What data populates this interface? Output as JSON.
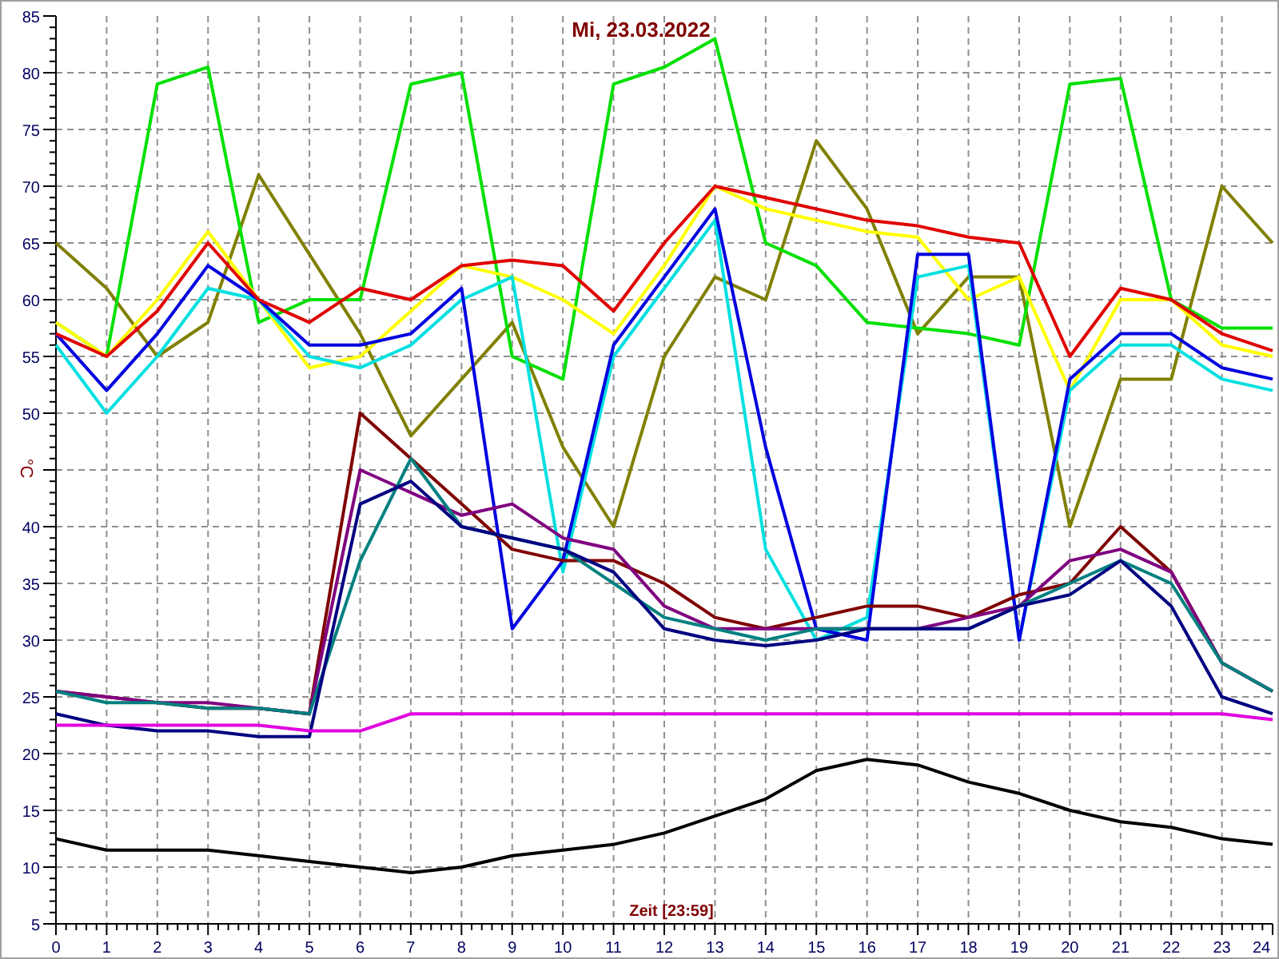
{
  "chart": {
    "chart_data": {
      "type": "line",
      "title": "Mi, 23.03.2022",
      "xlabel": "Zeit [23:59]",
      "ylabel": "°C",
      "grid": true,
      "x": [
        0,
        1,
        2,
        3,
        4,
        5,
        6,
        7,
        8,
        9,
        10,
        11,
        12,
        13,
        14,
        15,
        16,
        17,
        18,
        19,
        20,
        21,
        22,
        23,
        24
      ],
      "xlim": [
        0,
        24
      ],
      "ylim": [
        5,
        85
      ],
      "xticks": [
        0,
        1,
        2,
        3,
        4,
        5,
        6,
        7,
        8,
        9,
        10,
        11,
        12,
        13,
        14,
        15,
        16,
        17,
        18,
        19,
        20,
        21,
        22,
        23,
        24
      ],
      "yticks": [
        5,
        10,
        15,
        20,
        25,
        30,
        35,
        40,
        50,
        55,
        60,
        65,
        70,
        75,
        80,
        85
      ],
      "series": [
        {
          "color": "#808000",
          "values": [
            65,
            61,
            55,
            58,
            71,
            64,
            57,
            48,
            53,
            58,
            47,
            40,
            55,
            62,
            60,
            74,
            68,
            57,
            62,
            62,
            40,
            53,
            53,
            70,
            65
          ]
        },
        {
          "color": "#00e000",
          "values": [
            58,
            55,
            79,
            80.5,
            58,
            60,
            60,
            79,
            80,
            55,
            53,
            79,
            80.5,
            83,
            65,
            63,
            58,
            57.5,
            57,
            56,
            79,
            79.5,
            60,
            57.5,
            57.5
          ]
        },
        {
          "color": "#ffff00",
          "values": [
            58,
            55,
            60,
            66,
            60,
            54,
            55,
            59,
            63,
            62,
            60,
            57,
            63,
            70,
            68,
            67,
            66,
            65.5,
            60,
            62,
            52,
            60,
            60,
            56,
            55
          ]
        },
        {
          "color": "#00e0e0",
          "values": [
            56,
            50,
            55,
            61,
            60,
            55,
            54,
            56,
            60,
            62,
            36,
            55,
            61,
            67,
            38,
            30,
            32,
            62,
            63,
            30,
            52,
            56,
            56,
            53,
            52
          ]
        },
        {
          "color": "#0000e0",
          "values": [
            57,
            52,
            57,
            63,
            60,
            56,
            56,
            57,
            61,
            31,
            37,
            56,
            62,
            68,
            47,
            31,
            30,
            64,
            64,
            30,
            53,
            57,
            57,
            54,
            53
          ]
        },
        {
          "color": "#e00000",
          "values": [
            57,
            55,
            59,
            65,
            60,
            58,
            61,
            60,
            63,
            63.5,
            63,
            59,
            65,
            70,
            69,
            68,
            67,
            66.5,
            65.5,
            65,
            55,
            61,
            60,
            57,
            55.5
          ]
        },
        {
          "color": "#800000",
          "values": [
            25.5,
            25,
            24.5,
            24,
            24,
            23.5,
            50,
            46,
            42,
            38,
            37,
            37,
            35,
            32,
            31,
            32,
            33,
            33,
            32,
            34,
            35,
            40,
            36,
            28,
            25.5
          ]
        },
        {
          "color": "#800080",
          "values": [
            25.5,
            25,
            24.5,
            24.5,
            24,
            23.5,
            45,
            43,
            41,
            42,
            39,
            38,
            33,
            31,
            31,
            31,
            31,
            31,
            32,
            33,
            37,
            38,
            36,
            28,
            25.5
          ]
        },
        {
          "color": "#008080",
          "values": [
            25.5,
            24.5,
            24.5,
            24,
            24,
            23.5,
            37,
            46,
            40,
            39,
            38,
            35,
            32,
            31,
            30,
            31,
            31,
            31,
            31,
            33,
            35,
            37,
            35,
            28,
            25.5
          ]
        },
        {
          "color": "#000080",
          "values": [
            23.5,
            22.5,
            22,
            22,
            21.5,
            21.5,
            42,
            44,
            40,
            39,
            38,
            36,
            31,
            30,
            29.5,
            30,
            31,
            31,
            31,
            33,
            34,
            37,
            33,
            25,
            23.5
          ]
        },
        {
          "color": "#e000e0",
          "values": [
            22.5,
            22.5,
            22.5,
            22.5,
            22.5,
            22,
            22,
            23.5,
            23.5,
            23.5,
            23.5,
            23.5,
            23.5,
            23.5,
            23.5,
            23.5,
            23.5,
            23.5,
            23.5,
            23.5,
            23.5,
            23.5,
            23.5,
            23.5,
            23
          ]
        },
        {
          "color": "#000000",
          "values": [
            12.5,
            11.5,
            11.5,
            11.5,
            11,
            10.5,
            10,
            9.5,
            10,
            11,
            11.5,
            12,
            13,
            14.5,
            16,
            18.5,
            19.5,
            19,
            17.5,
            16.5,
            15,
            14,
            13.5,
            12.5,
            12
          ]
        }
      ]
    }
  }
}
